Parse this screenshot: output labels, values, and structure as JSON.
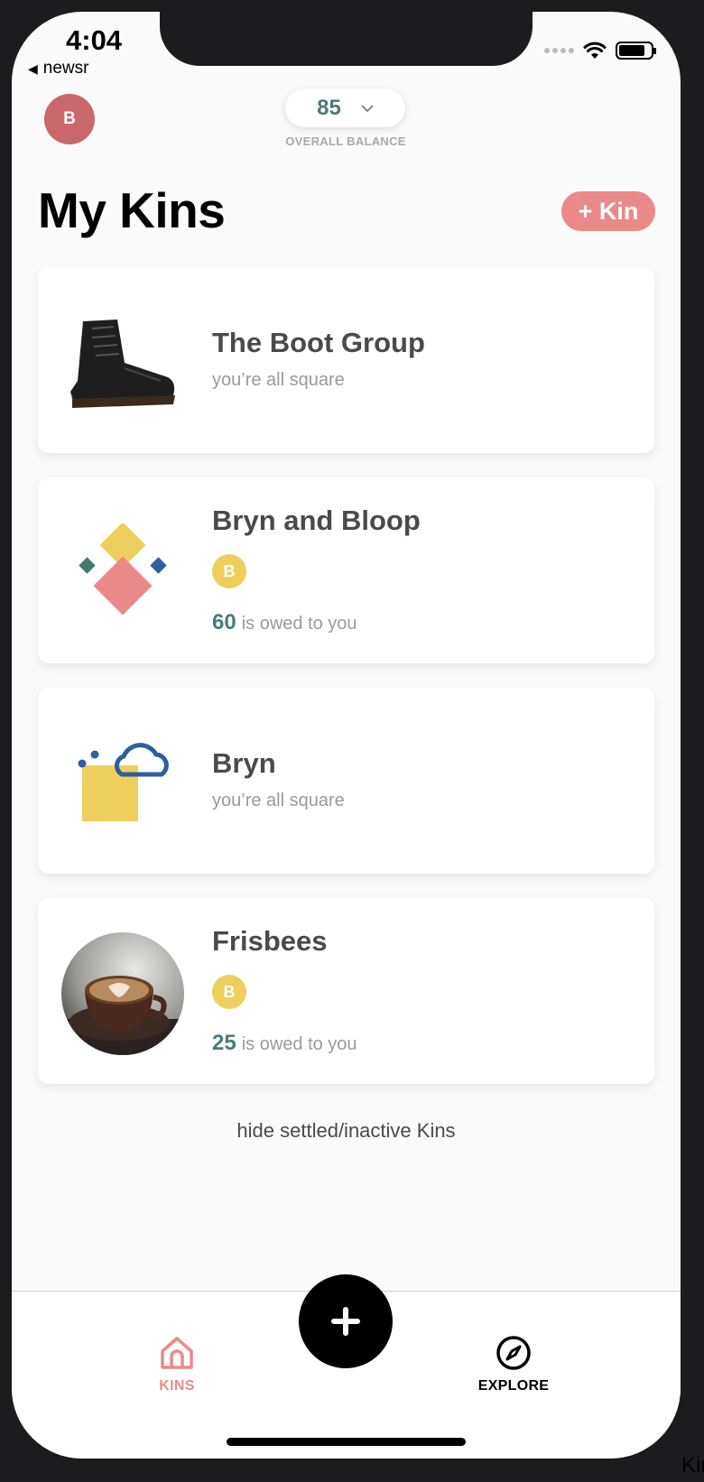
{
  "status_bar": {
    "time": "4:04",
    "back_app": "newsr"
  },
  "header": {
    "avatar_initial": "B",
    "balance_value": "85",
    "balance_label": "OVERALL BALANCE"
  },
  "page": {
    "title": "My Kins",
    "add_button": "+ Kin"
  },
  "kins": [
    {
      "name": "The Boot Group",
      "status": "you’re all square",
      "icon": "boot-image"
    },
    {
      "name": "Bryn and Bloop",
      "member_initial": "B",
      "amount": "60",
      "owed_text": "is owed to you",
      "icon": "diamond-shapes-icon"
    },
    {
      "name": "Bryn",
      "status": "you’re all square",
      "icon": "cloud-square-icon"
    },
    {
      "name": "Frisbees",
      "member_initial": "B",
      "amount": "25",
      "owed_text": "is owed to you",
      "icon": "coffee-image"
    }
  ],
  "hide_link": "hide settled/inactive Kins",
  "bottom_nav": {
    "kins_label": "KINS",
    "explore_label": "EXPLORE"
  },
  "colors": {
    "accent": "#ea8a88",
    "teal": "#4d7a7a",
    "member_yellow": "#eecf5e",
    "avatar_red": "#c9686a"
  },
  "corner_fragment": "Kin"
}
